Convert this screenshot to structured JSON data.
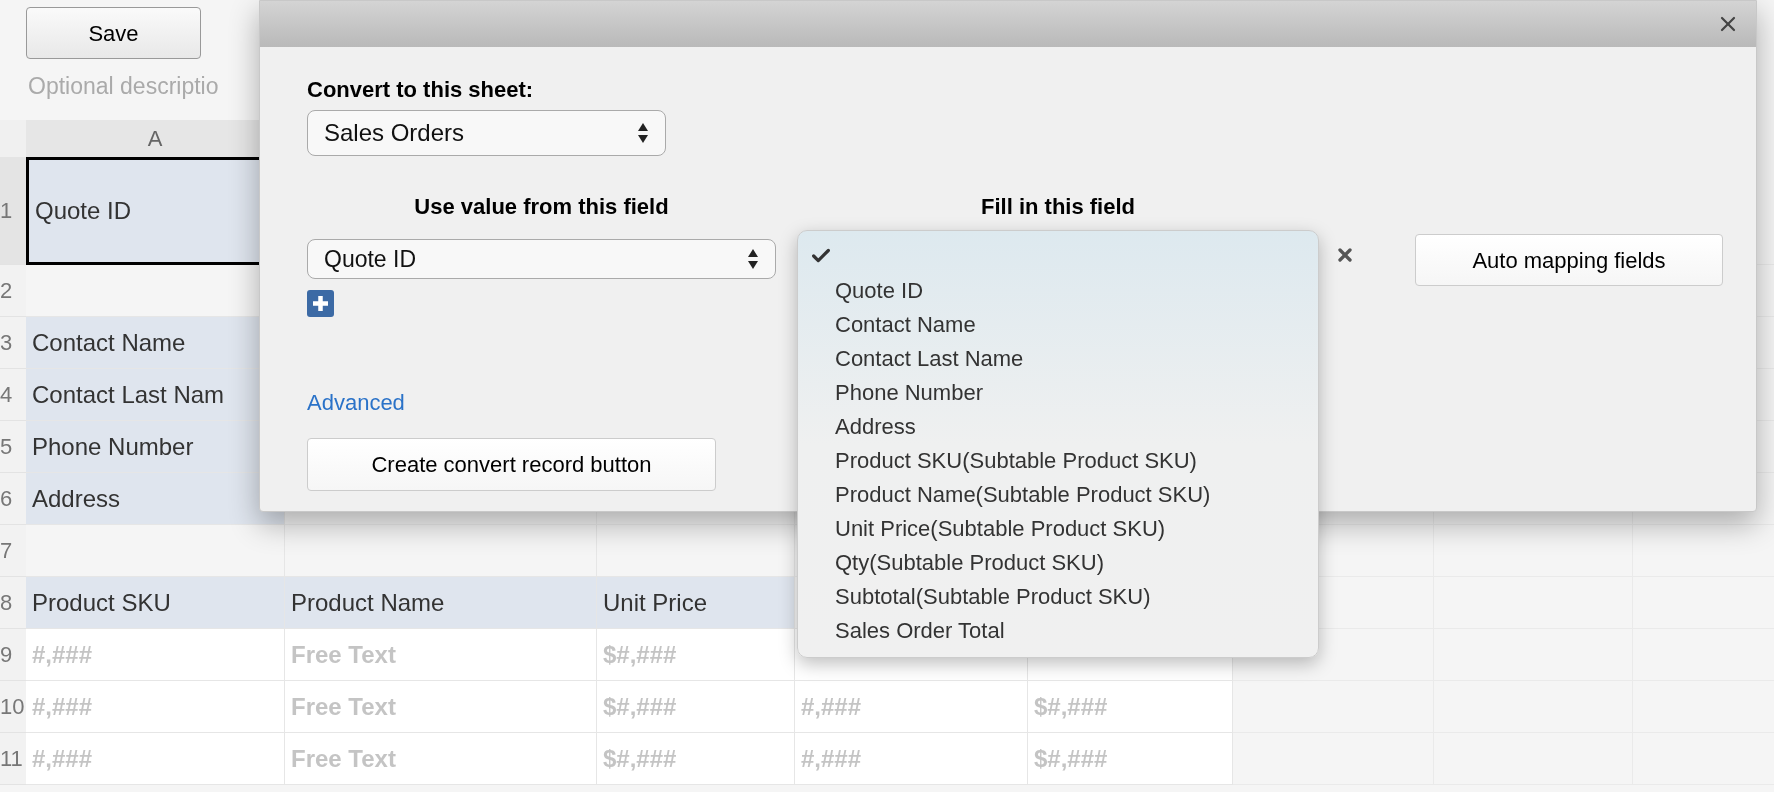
{
  "toolbar": {
    "save_button": "Save",
    "description_field": {
      "placeholder": "Optional descriptio"
    }
  },
  "sheet": {
    "columns": [
      "A"
    ],
    "rows": [
      {
        "number": "1",
        "cells": [
          {
            "text": "Quote ID",
            "kind": "label",
            "selected": true
          }
        ]
      },
      {
        "number": "2",
        "cells": [
          {
            "kind": "blank",
            "selected": false
          }
        ]
      },
      {
        "number": "3",
        "cells": [
          {
            "text": "Contact Name",
            "kind": "label",
            "selected": false
          }
        ]
      },
      {
        "number": "4",
        "cells": [
          {
            "text": "Contact Last Nam",
            "kind": "label",
            "selected": false
          }
        ]
      },
      {
        "number": "5",
        "cells": [
          {
            "text": "Phone Number",
            "kind": "label",
            "selected": false
          }
        ]
      },
      {
        "number": "6",
        "cells": [
          {
            "text": "Address",
            "kind": "label",
            "selected": false
          }
        ]
      },
      {
        "number": "7",
        "cells": [
          {
            "kind": "blank",
            "selected": false
          },
          {
            "kind": "blank",
            "selected": false
          },
          {
            "kind": "blank",
            "selected": false
          }
        ]
      },
      {
        "number": "8",
        "cells": [
          {
            "text": "Product SKU",
            "kind": "label",
            "selected": false
          },
          {
            "text": "Product Name",
            "kind": "label",
            "selected": false
          },
          {
            "text": "Unit Price",
            "kind": "label",
            "selected": false
          }
        ]
      },
      {
        "number": "9",
        "cells": [
          {
            "text": "#,###",
            "kind": "format",
            "selected": false
          },
          {
            "text": "Free Text",
            "kind": "format",
            "selected": false
          },
          {
            "text": "$#,###",
            "kind": "format",
            "selected": false
          },
          {
            "kind": "format",
            "selected": false
          },
          {
            "kind": "format",
            "selected": false
          }
        ]
      },
      {
        "number": "10",
        "cells": [
          {
            "text": "#,###",
            "kind": "format",
            "selected": false
          },
          {
            "text": "Free Text",
            "kind": "format",
            "selected": false
          },
          {
            "text": "$#,###",
            "kind": "format",
            "selected": false
          },
          {
            "text": "#,###",
            "kind": "format",
            "selected": false
          },
          {
            "text": "$#,###",
            "kind": "format",
            "selected": false
          }
        ]
      },
      {
        "number": "11",
        "cells": [
          {
            "text": "#,###",
            "kind": "format",
            "selected": false
          },
          {
            "text": "Free Text",
            "kind": "format",
            "selected": false
          },
          {
            "text": "$#,###",
            "kind": "format",
            "selected": false
          },
          {
            "text": "#,###",
            "kind": "format",
            "selected": false
          },
          {
            "text": "$#,###",
            "kind": "format",
            "selected": false
          }
        ]
      }
    ]
  },
  "dialog": {
    "target_label": "Convert to this sheet:",
    "target_select": "Sales Orders",
    "source_heading": "Use value from this field",
    "target_heading": "Fill in this field",
    "source_select": "Quote ID",
    "fill_dropdown": {
      "blank_option": {
        "selected": true
      },
      "options": [
        {
          "label": "Quote ID",
          "selected": false
        },
        {
          "label": "Contact Name",
          "selected": false
        },
        {
          "label": "Contact Last Name",
          "selected": false
        },
        {
          "label": "Phone Number",
          "selected": false
        },
        {
          "label": "Address",
          "selected": false
        },
        {
          "label": "Product SKU(Subtable Product SKU)",
          "selected": false
        },
        {
          "label": "Product Name(Subtable Product SKU)",
          "selected": false
        },
        {
          "label": "Unit Price(Subtable Product SKU)",
          "selected": false
        },
        {
          "label": "Qty(Subtable Product SKU)",
          "selected": false
        },
        {
          "label": "Subtotal(Subtable Product SKU)",
          "selected": false
        },
        {
          "label": "Sales Order Total",
          "selected": false
        }
      ]
    },
    "advanced_link": "Advanced",
    "create_button": "Create convert record button",
    "auto_button": "Auto mapping fields"
  }
}
